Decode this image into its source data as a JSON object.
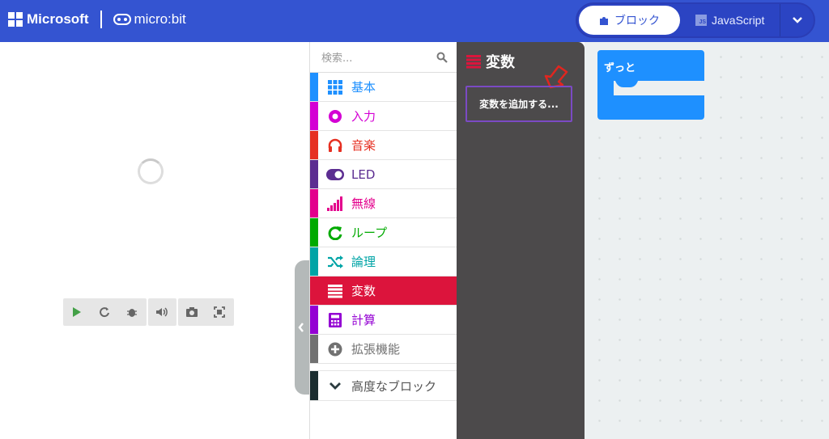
{
  "header": {
    "brand": "Microsoft",
    "product": "micro:bit",
    "toggle": {
      "blocks_label": "ブロック",
      "js_label": "JavaScript",
      "js_badge": "JS"
    },
    "color": "#3454d1"
  },
  "toolbox": {
    "search_placeholder": "検索...",
    "categories": [
      {
        "label": "基本",
        "color": "#1e90ff",
        "icon": "grid-icon"
      },
      {
        "label": "入力",
        "color": "#d400d4",
        "icon": "circle-target-icon"
      },
      {
        "label": "音楽",
        "color": "#e63022",
        "icon": "headphones-icon"
      },
      {
        "label": "LED",
        "color": "#5c2d91",
        "icon": "toggle-icon"
      },
      {
        "label": "無線",
        "color": "#e3008c",
        "icon": "signal-bars-icon"
      },
      {
        "label": "ループ",
        "color": "#00aa00",
        "icon": "loop-arrow-icon"
      },
      {
        "label": "論理",
        "color": "#00a4a6",
        "icon": "shuffle-icon"
      },
      {
        "label": "変数",
        "color": "#dc143c",
        "icon": "list-icon",
        "selected": true
      },
      {
        "label": "計算",
        "color": "#9400d3",
        "icon": "calculator-icon"
      },
      {
        "label": "拡張機能",
        "color": "#717171",
        "icon": "plus-circle-icon"
      }
    ],
    "advanced_label": "高度なブロック"
  },
  "flyout": {
    "title": "変数",
    "add_variable_label": "変数を追加する..."
  },
  "workspace": {
    "forever_block_label": "ずっと",
    "block_color": "#1e90ff"
  }
}
